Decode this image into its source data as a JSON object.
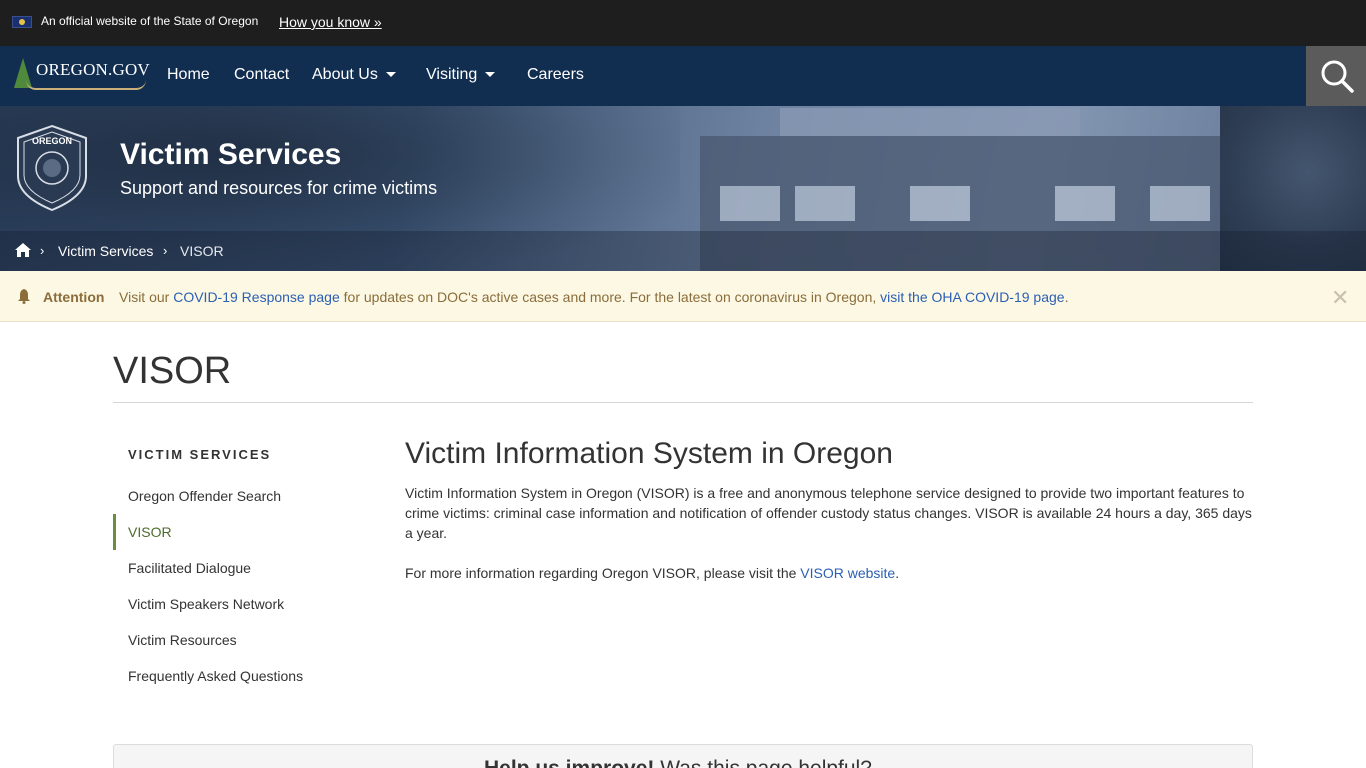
{
  "gov_banner": {
    "text": "An official website of the State of Oregon",
    "link": "How you know »"
  },
  "nav": {
    "logo": "OREGON.GOV",
    "items": [
      {
        "label": "Home"
      },
      {
        "label": "Contact"
      },
      {
        "label": "About Us"
      },
      {
        "label": "Visiting"
      },
      {
        "label": "Careers"
      }
    ]
  },
  "hero": {
    "seal_text": "OREGON",
    "title": "Victim Services",
    "subtitle": "Support and resources for crime victims"
  },
  "breadcrumb": {
    "items": [
      "Victim Services"
    ],
    "current": "VISOR"
  },
  "alert": {
    "label": "Attention",
    "text_1": "Visit our ",
    "link_1": "COVID-19 Response page",
    "text_2": " for updates on DOC's active cases and more. For the latest on coronavirus in Oregon, ",
    "link_2": "visit the OHA COVID-19 page",
    "text_3": "."
  },
  "page": {
    "title": "VISOR"
  },
  "sidebar": {
    "heading": "VICTIM SERVICES",
    "items": [
      {
        "label": "Oregon Offender Search"
      },
      {
        "label": "VISOR"
      },
      {
        "label": "Facilitated Dialogue"
      },
      {
        "label": "Victim Speakers Network"
      },
      {
        "label": "Victim Resources"
      },
      {
        "label": "Frequently Asked Questions"
      }
    ]
  },
  "content": {
    "title": "Victim Information System in Oregon",
    "paragraph_1": "Victim Information System in Oregon (VISOR) is a free and anonymous telephone service designed to provide two important features to crime victims: criminal case information and notification of offender custody status changes. VISOR is available 24 hours a day, 365 days a year.",
    "paragraph_2_text": "For more information regarding Oregon VISOR, please visit the ",
    "paragraph_2_link": "VISOR website",
    "paragraph_2_end": "."
  },
  "feedback": {
    "bold": "Help us improve!",
    "text": " Was this page helpful?"
  },
  "colors": {
    "nav_bg": "#112e51",
    "banner_bg": "#1e1e1e",
    "link": "#2b5fb3",
    "alert_bg": "#fcf8e3",
    "active_green": "#6b8e3e"
  }
}
